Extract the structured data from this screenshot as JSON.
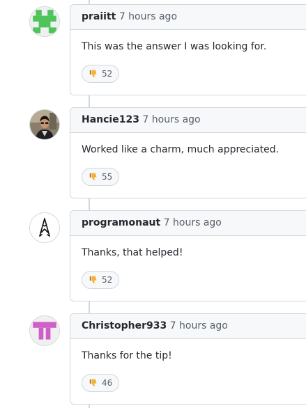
{
  "comments": [
    {
      "author": "praiitt",
      "time": "7 hours ago",
      "body": "This was the answer I was looking for.",
      "reaction": {
        "icon": "thumbs-down-icon",
        "count": "52"
      },
      "avatar": {
        "type": "identicon",
        "color": "#4fc45a"
      }
    },
    {
      "author": "Hancie123",
      "time": "7 hours ago",
      "body": "Worked like a charm, much appreciated.",
      "reaction": {
        "icon": "thumbs-down-icon",
        "count": "55"
      },
      "avatar": {
        "type": "photo"
      }
    },
    {
      "author": "programonaut",
      "time": "7 hours ago",
      "body": "Thanks, that helped!",
      "reaction": {
        "icon": "thumbs-down-icon",
        "count": "52"
      },
      "avatar": {
        "type": "logo"
      }
    },
    {
      "author": "Christopher933",
      "time": "7 hours ago",
      "body": "Thanks for the tip!",
      "reaction": {
        "icon": "thumbs-down-icon",
        "count": "46"
      },
      "avatar": {
        "type": "identicon",
        "color": "#d05fc7"
      }
    }
  ]
}
